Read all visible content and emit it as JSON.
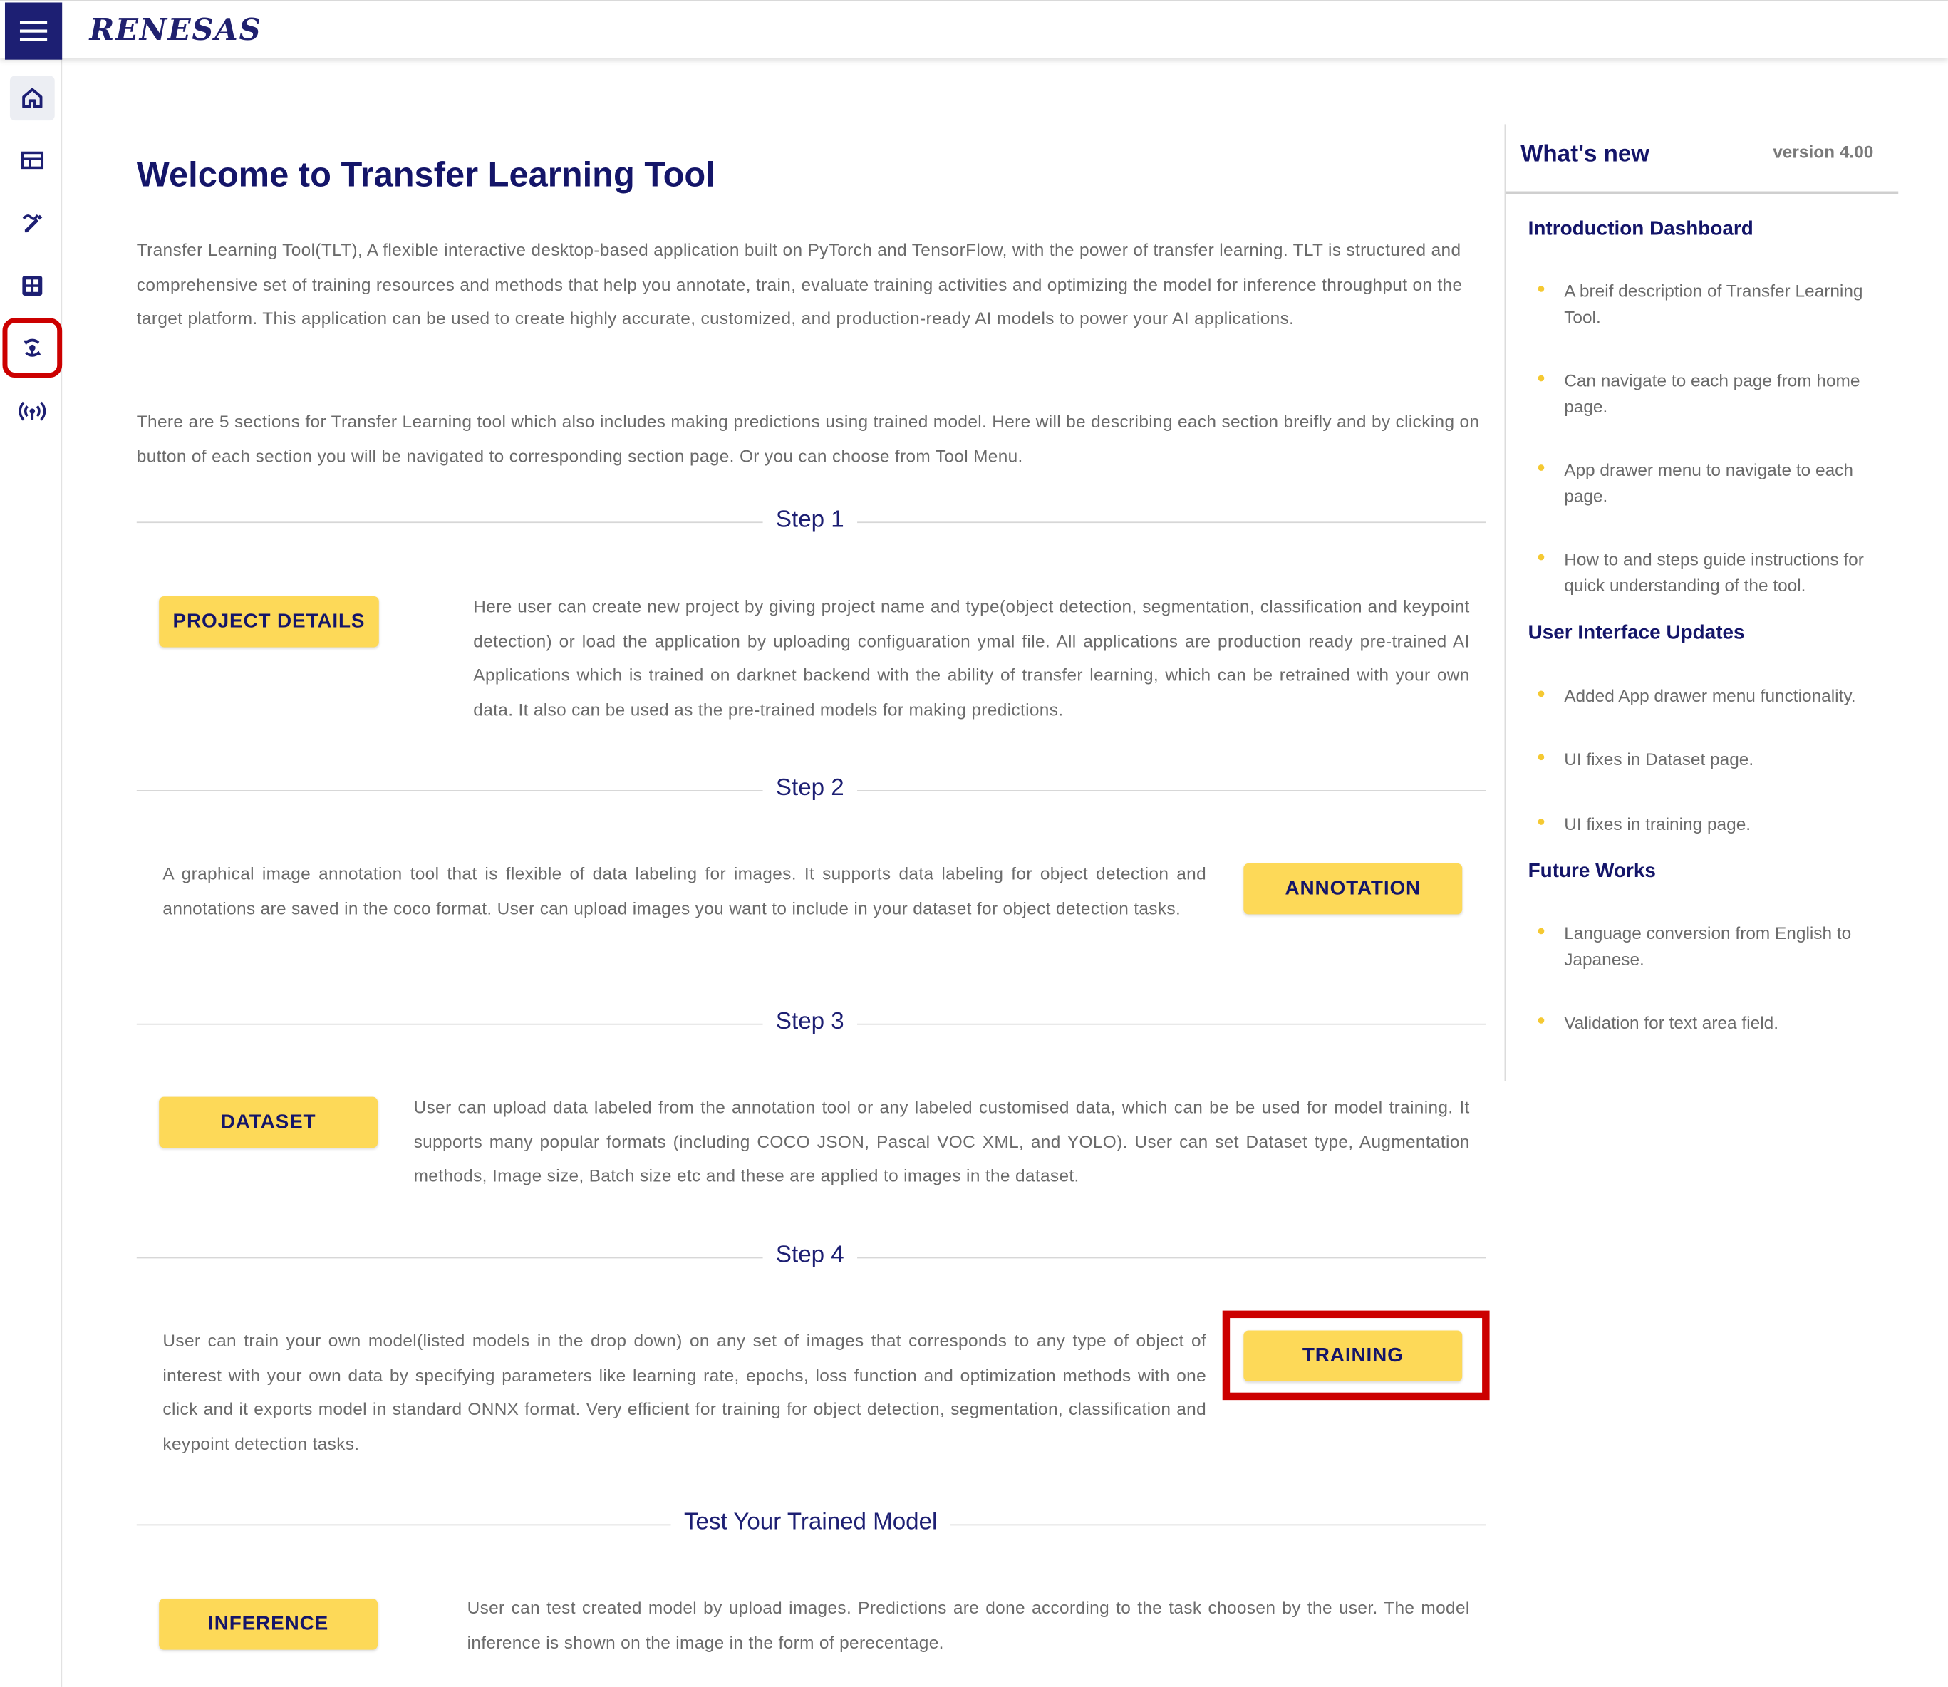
{
  "header": {
    "logo_text": "RENESAS"
  },
  "sidebar": {
    "items": [
      {
        "icon": "home-icon"
      },
      {
        "icon": "dashboard-icon"
      },
      {
        "icon": "annotation-icon"
      },
      {
        "icon": "dataset-icon"
      },
      {
        "icon": "training-icon"
      },
      {
        "icon": "inference-icon"
      }
    ]
  },
  "main": {
    "title": "Welcome to Transfer Learning Tool",
    "intro_1": "Transfer Learning Tool(TLT), A flexible interactive desktop-based application built on PyTorch and TensorFlow, with the power of transfer learning. TLT is structured and comprehensive set of training resources and methods that help you annotate, train, evaluate training activities and optimizing the model for inference throughput on the target platform. This application can be used to create highly accurate, customized, and production-ready AI models to power your AI applications.",
    "intro_2": "There are 5 sections for Transfer Learning tool which also includes making predictions using trained model. Here will be describing each section breifly and by clicking on button of each section you will be navigated to corresponding section page. Or you can choose from Tool Menu.",
    "steps": [
      {
        "label": "Step 1",
        "button": "PROJECT DETAILS",
        "description": "Here user can create new project by giving project name and type(object detection, segmentation, classification and keypoint detection) or load the application by uploading configuaration ymal file. All applications are production ready pre-trained AI Applications which is trained on darknet backend with the ability of transfer learning, which can be retrained with your own data. It also can be used as the pre-trained models for making predictions."
      },
      {
        "label": "Step 2",
        "button": "ANNOTATION",
        "description": "A graphical image annotation tool that is flexible of data labeling for images. It supports data labeling for object detection and annotations are saved in the coco format. User can upload images you want to include in your dataset for object detection tasks."
      },
      {
        "label": "Step 3",
        "button": "DATASET",
        "description": "User can upload data labeled from the annotation tool or any labeled customised data, which can be be used for model training. It supports many popular formats (including COCO JSON, Pascal VOC XML, and YOLO). User can set Dataset type, Augmentation methods, Image size, Batch size etc and these are applied to images in the dataset."
      },
      {
        "label": "Step 4",
        "button": "TRAINING",
        "description": "User can train your own model(listed models in the drop down) on any set of images that corresponds to any type of object of interest with your own data by specifying parameters like learning rate, epochs, loss function and optimization methods with one click and it exports model in standard ONNX format. Very efficient for training for object detection, segmentation, classification and keypoint detection tasks."
      },
      {
        "label": "Test Your Trained Model",
        "button": "INFERENCE",
        "description": "User can test created model by upload images. Predictions are done according to the task choosen by the user. The model inference is shown on the image in the form of perecentage."
      }
    ]
  },
  "whats_new": {
    "title": "What's new",
    "version": "version 4.00",
    "sections": [
      {
        "heading": "Introduction Dashboard",
        "items": [
          "A breif description of Transfer Learning Tool.",
          "Can navigate to each page from home page.",
          "App drawer menu to navigate to each page.",
          "How to and steps guide instructions for quick understanding of the tool."
        ]
      },
      {
        "heading": "User Interface Updates",
        "items": [
          "Added App drawer menu functionality.",
          "UI fixes in Dataset page.",
          "UI fixes in training page."
        ]
      },
      {
        "heading": "Future Works",
        "items": [
          "Language conversion from English to Japanese.",
          "Validation for text area field."
        ]
      }
    ]
  },
  "colors": {
    "brand_navy": "#1d1f73",
    "button_yellow": "#fdd958",
    "highlight_red": "#cc0000"
  }
}
